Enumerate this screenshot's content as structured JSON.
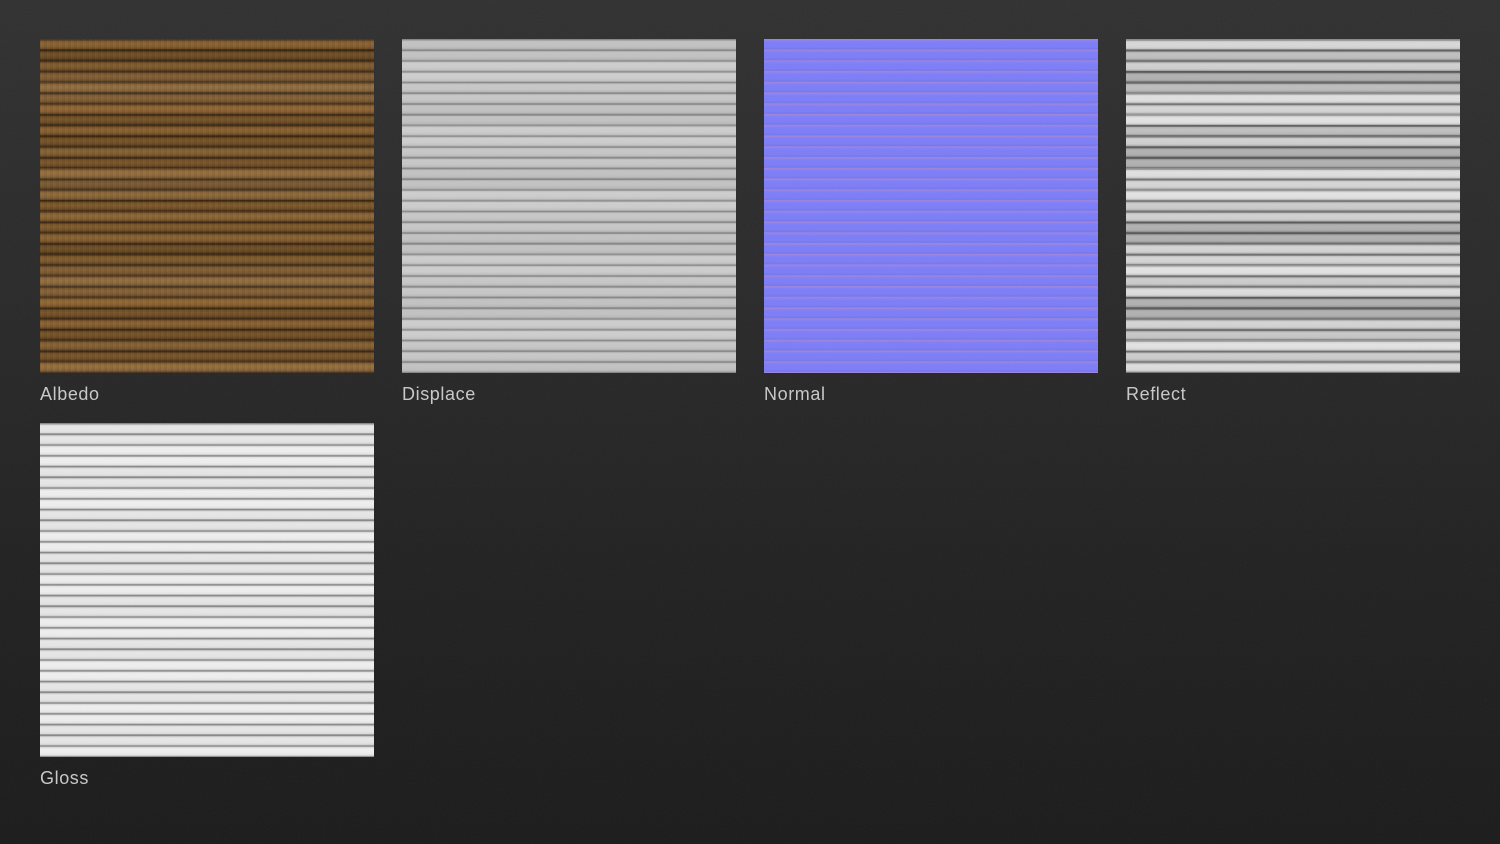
{
  "page": {
    "background_top_color": "#313131",
    "background_bottom_color": "#1b1b1b",
    "label_color": "#c9c9c9"
  },
  "texture_maps": [
    {
      "label": "Albedo",
      "appearance": "brown wood plank color texture, horizontal planks",
      "base_color": "#74512a"
    },
    {
      "label": "Displace",
      "appearance": "light gray displacement map with horizontal plank seams",
      "base_color": "#c8c8c8"
    },
    {
      "label": "Normal",
      "appearance": "periwinkle tangent-space normal map with faint horizontal seam lines",
      "base_color": "#7d7df8"
    },
    {
      "label": "Reflect",
      "appearance": "gray reflection map, horizontal planks of varying brightness",
      "base_color": "#cfcfcf"
    },
    {
      "label": "Gloss",
      "appearance": "near-white gloss map with thin horizontal seam lines",
      "base_color": "#ececec"
    }
  ]
}
